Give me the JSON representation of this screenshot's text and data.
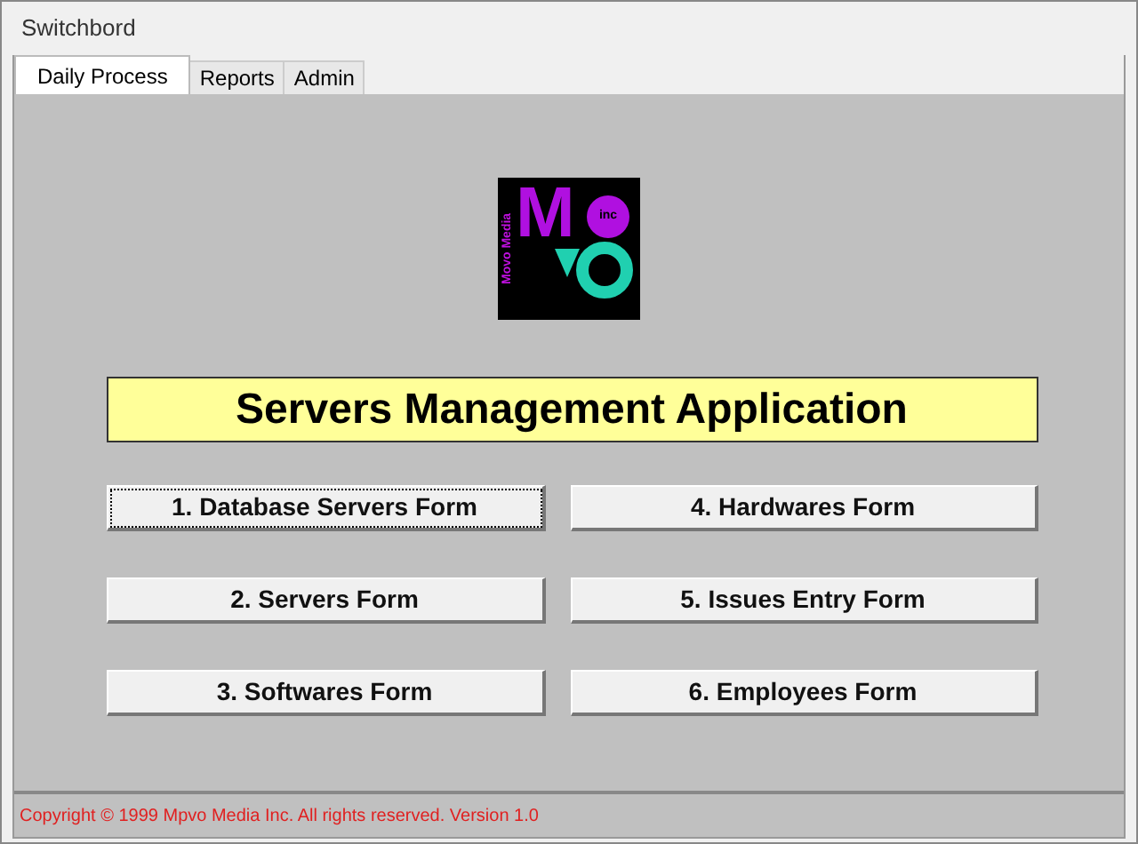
{
  "window": {
    "title": "Switchbord"
  },
  "tabs": [
    {
      "label": "Daily Process",
      "selected": true
    },
    {
      "label": "Reports",
      "selected": false
    },
    {
      "label": "Admin",
      "selected": false
    }
  ],
  "logo": {
    "letter": "M",
    "side_text": "Movo Media",
    "small_text": "inc"
  },
  "banner": "Servers Management Application",
  "buttons": [
    {
      "label": "1. Database Servers Form",
      "focused": true
    },
    {
      "label": "4. Hardwares Form",
      "focused": false
    },
    {
      "label": "2. Servers Form",
      "focused": false
    },
    {
      "label": "5.  Issues Entry Form",
      "focused": false
    },
    {
      "label": "3. Softwares Form",
      "focused": false
    },
    {
      "label": "6. Employees Form",
      "focused": false
    }
  ],
  "status_bar": "Copyright © 1999 Mpvo Media Inc. All rights reserved. Version 1.0"
}
